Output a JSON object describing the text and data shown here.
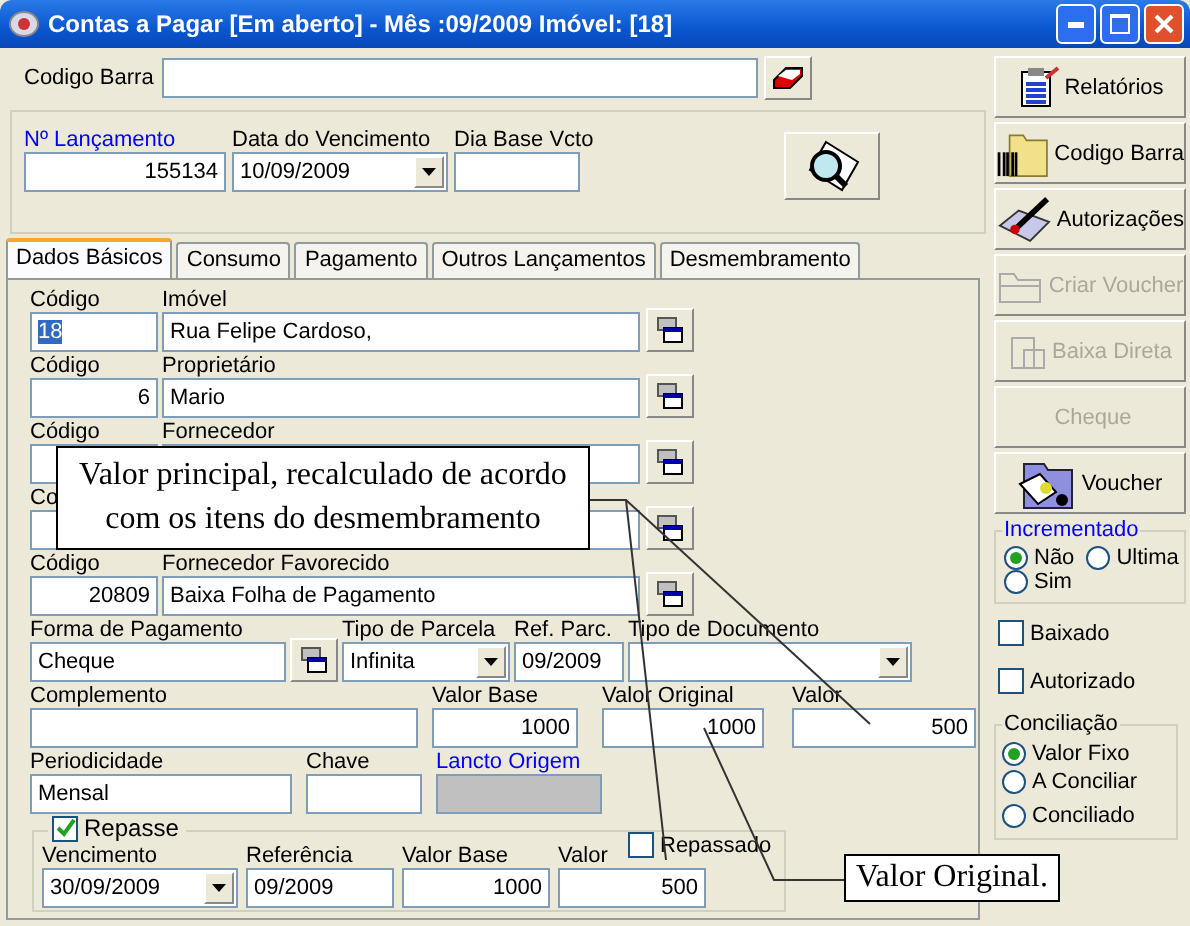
{
  "window": {
    "title": "Contas a Pagar [Em aberto] - Mês :09/2009 Imóvel: [18]"
  },
  "barcode": {
    "label": "Codigo Barra"
  },
  "header": {
    "numero": {
      "label": "Nº Lançamento",
      "value": "155134"
    },
    "vencimento": {
      "label": "Data do Vencimento",
      "value": "10/09/2009"
    },
    "dia_base": {
      "label": "Dia Base Vcto"
    }
  },
  "tabs": [
    {
      "label": "Dados Básicos",
      "selected": true
    },
    {
      "label": "Consumo",
      "selected": false
    },
    {
      "label": "Pagamento",
      "selected": false
    },
    {
      "label": "Outros Lançamentos",
      "selected": false
    },
    {
      "label": "Desmembramento",
      "selected": false
    }
  ],
  "lookups": [
    {
      "code_label": "Código",
      "code": "18",
      "highlighted": true,
      "name_label": "Imóvel",
      "name": "Rua Felipe Cardoso,"
    },
    {
      "code_label": "Código",
      "code": "6",
      "highlighted": false,
      "name_label": "Proprietário",
      "name": "Mario"
    },
    {
      "code_label": "Código",
      "name_label": "Fornecedor"
    },
    {
      "code_label": "Co"
    },
    {
      "code_label": "Código",
      "code": "20809",
      "highlighted": false,
      "name_label": "Fornecedor Favorecido",
      "name": "Baixa Folha de Pagamento"
    }
  ],
  "payment": {
    "forma": {
      "label": "Forma de Pagamento",
      "value": "Cheque"
    },
    "tipo_parcela": {
      "label": "Tipo de Parcela",
      "value": "Infinita"
    },
    "ref_parc": {
      "label": "Ref. Parc.",
      "value": "09/2009"
    },
    "tipo_documento": {
      "label": "Tipo de Documento"
    }
  },
  "amounts": {
    "complemento": {
      "label": "Complemento"
    },
    "valor_base": {
      "label": "Valor Base",
      "value": "1000"
    },
    "valor_original": {
      "label": "Valor Original",
      "value": "1000"
    },
    "valor": {
      "label": "Valor",
      "value": "500"
    }
  },
  "misc": {
    "periodicidade": {
      "label": "Periodicidade",
      "value": "Mensal"
    },
    "chave": {
      "label": "Chave"
    },
    "lancto_origem": {
      "label": "Lancto Origem"
    }
  },
  "repasse": {
    "label": "Repasse",
    "checked": true,
    "vencimento": {
      "label": "Vencimento",
      "value": "30/09/2009"
    },
    "referencia": {
      "label": "Referência",
      "value": "09/2009"
    },
    "valor_base": {
      "label": "Valor Base",
      "value": "1000"
    },
    "valor": {
      "label": "Valor",
      "value": "500"
    },
    "repassado": {
      "label": "Repassado",
      "checked": false
    }
  },
  "callouts": [
    {
      "text": "Valor principal, recalculado de acordo com os itens do desmembramento"
    },
    {
      "text": "Valor Original."
    }
  ],
  "sidebar": [
    {
      "label": "Relatórios",
      "disabled": false
    },
    {
      "label": "Codigo Barra",
      "disabled": false
    },
    {
      "label": "Autorizações",
      "disabled": false
    },
    {
      "label": "Criar Voucher",
      "disabled": true
    },
    {
      "label": "Baixa Direta",
      "disabled": true
    },
    {
      "label": "Cheque",
      "disabled": true
    },
    {
      "label": "Voucher",
      "disabled": false
    }
  ],
  "incrementado": {
    "label": "Incrementado",
    "options": [
      {
        "label": "Não",
        "selected": true
      },
      {
        "label": "Ultima",
        "selected": false
      },
      {
        "label": "Sim",
        "selected": false
      }
    ]
  },
  "flags": [
    {
      "label": "Baixado",
      "checked": false
    },
    {
      "label": "Autorizado",
      "checked": false
    }
  ],
  "conciliacao": {
    "label": "Conciliação",
    "options": [
      {
        "label": "Valor Fixo",
        "selected": true
      },
      {
        "label": "A Conciliar",
        "selected": false
      },
      {
        "label": "Conciliado",
        "selected": false
      }
    ]
  }
}
